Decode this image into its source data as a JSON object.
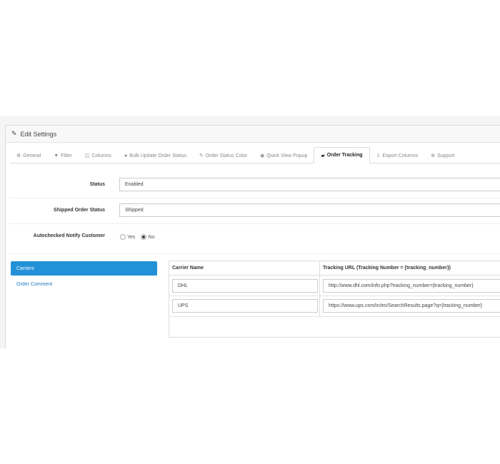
{
  "panel": {
    "title": "Edit Settings",
    "title_icon": "pencil-icon"
  },
  "tabs": [
    {
      "label": "General",
      "icon": "gear-icon"
    },
    {
      "label": "Filter",
      "icon": "filter-icon"
    },
    {
      "label": "Columns",
      "icon": "columns-icon"
    },
    {
      "label": "Bulk Update Order Status",
      "icon": "comment-icon"
    },
    {
      "label": "Order Status Color",
      "icon": "brush-icon"
    },
    {
      "label": "Quick View Popup",
      "icon": "eye-icon"
    },
    {
      "label": "Order Tracking",
      "icon": "truck-icon",
      "active": true
    },
    {
      "label": "Export Columns",
      "icon": "download-icon"
    },
    {
      "label": "Support",
      "icon": "lifebuoy-icon"
    }
  ],
  "form": {
    "status_label": "Status",
    "status_value": "Enabled",
    "shipped_label": "Shipped Order Status",
    "shipped_value": "Shipped",
    "notify_label": "Autochecked Notify Customer",
    "notify_yes": "Yes",
    "notify_no": "No",
    "notify_selected": "No"
  },
  "sidenav": [
    {
      "label": "Carriers",
      "active": true
    },
    {
      "label": "Order Comment"
    }
  ],
  "carriers_table": {
    "headers": [
      "Carrier Name",
      "Tracking URL (Tracking Number = {tracking_number})"
    ],
    "rows": [
      {
        "name": "DHL",
        "url": "http://www.dhl.com/info.php?tracking_number={tracking_number}"
      },
      {
        "name": "UPS",
        "url": "https://www.ups.com/in/en/SearchResults.page?q={tracking_number}"
      }
    ]
  }
}
